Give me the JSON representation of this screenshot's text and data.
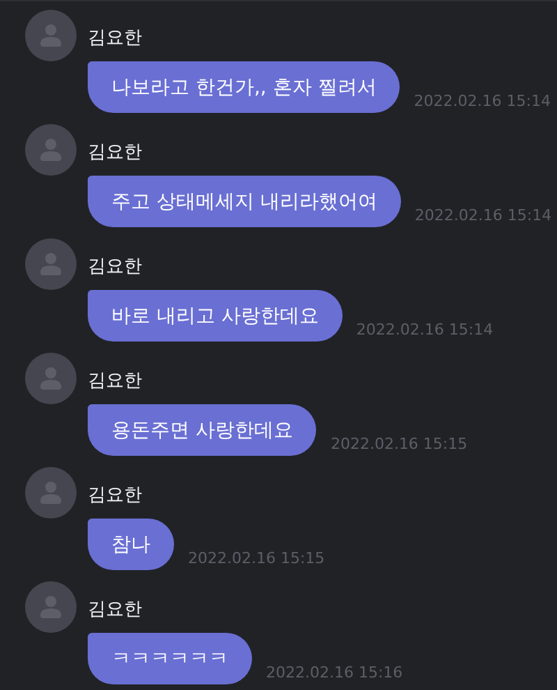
{
  "messages": [
    {
      "sender": "김요한",
      "text": "나보라고 한건가,, 혼자 찔려서",
      "time": "2022.02.16 15:14"
    },
    {
      "sender": "김요한",
      "text": "주고 상태메세지 내리라했어여",
      "time": "2022.02.16 15:14"
    },
    {
      "sender": "김요한",
      "text": "바로 내리고 사랑한데요",
      "time": "2022.02.16 15:14"
    },
    {
      "sender": "김요한",
      "text": "용돈주면 사랑한데요",
      "time": "2022.02.16 15:15"
    },
    {
      "sender": "김요한",
      "text": "참나",
      "time": "2022.02.16 15:15"
    },
    {
      "sender": "김요한",
      "text": "ㅋㅋㅋㅋㅋㅋ",
      "time": "2022.02.16 15:16"
    }
  ]
}
